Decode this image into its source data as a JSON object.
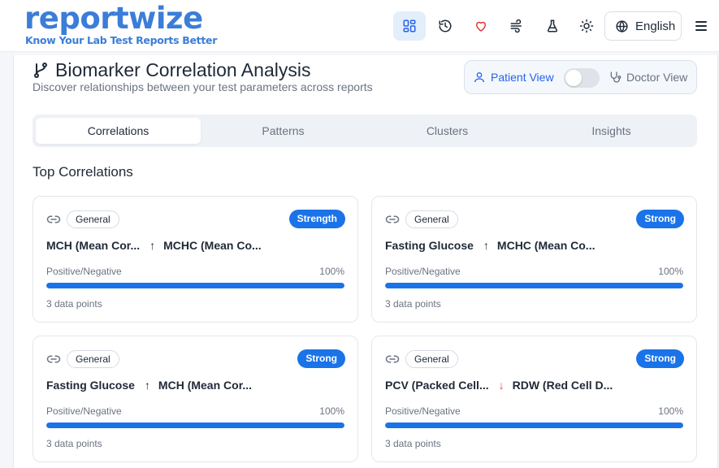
{
  "header": {
    "logo": "reportwize",
    "tagline": "Know Your Lab Test Reports Better",
    "nav_icons": [
      "dashboard-icon",
      "history-icon",
      "heart-icon",
      "flow-icon",
      "flask-icon",
      "sun-icon"
    ],
    "language": "English"
  },
  "page": {
    "title": "Biomarker Correlation Analysis",
    "subtitle": "Discover relationships between your test parameters across reports"
  },
  "view_toggle": {
    "patient_label": "Patient View",
    "doctor_label": "Doctor View",
    "doctor_mode_on": false
  },
  "tabs": [
    "Correlations",
    "Patterns",
    "Clusters",
    "Insights"
  ],
  "active_tab": "Correlations",
  "section": {
    "title": "Top Correlations"
  },
  "colors": {
    "accent": "#1a73e8",
    "brand": "#3b7dd8",
    "down_arrow": "#ef4444"
  },
  "cards": [
    {
      "category": "General",
      "strength": "Strength",
      "a": "MCH (Mean Cor...",
      "direction": "up",
      "arrow": "↑",
      "b": "MCHC (Mean Co...",
      "label": "Positive/Negative",
      "percent_text": "100%",
      "percent": 100,
      "points": "3 data points"
    },
    {
      "category": "General",
      "strength": "Strong",
      "a": "Fasting Glucose",
      "direction": "up",
      "arrow": "↑",
      "b": "MCHC (Mean Co...",
      "label": "Positive/Negative",
      "percent_text": "100%",
      "percent": 100,
      "points": "3 data points"
    },
    {
      "category": "General",
      "strength": "Strong",
      "a": "Fasting Glucose",
      "direction": "up",
      "arrow": "↑",
      "b": "MCH (Mean Cor...",
      "label": "Positive/Negative",
      "percent_text": "100%",
      "percent": 100,
      "points": "3 data points"
    },
    {
      "category": "General",
      "strength": "Strong",
      "a": "PCV (Packed Cell...",
      "direction": "down",
      "arrow": "↓",
      "b": "RDW (Red Cell D...",
      "label": "Positive/Negative",
      "percent_text": "100%",
      "percent": 100,
      "points": "3 data points"
    }
  ]
}
